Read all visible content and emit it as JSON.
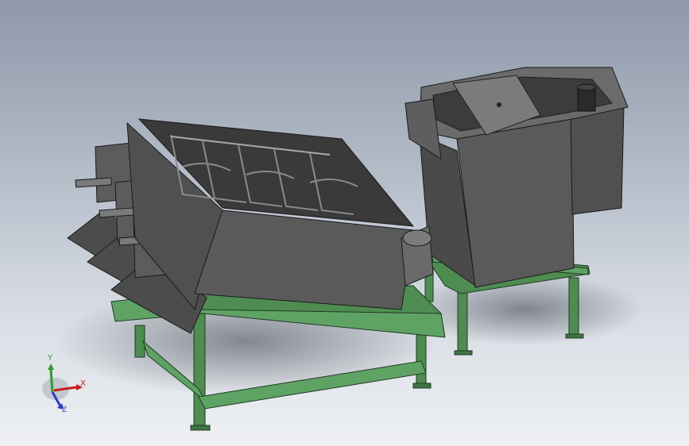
{
  "viewport": {
    "background_top": "#8e98a9",
    "background_bottom": "#eef0f3"
  },
  "model": {
    "frame_color": "#4e8c52",
    "body_color": "#565656"
  },
  "triad": {
    "x_label": "X",
    "y_label": "Y",
    "z_label": "Z",
    "x_color": "#c61e1e",
    "y_color": "#2f9a2f",
    "z_color": "#2b3fbf"
  }
}
